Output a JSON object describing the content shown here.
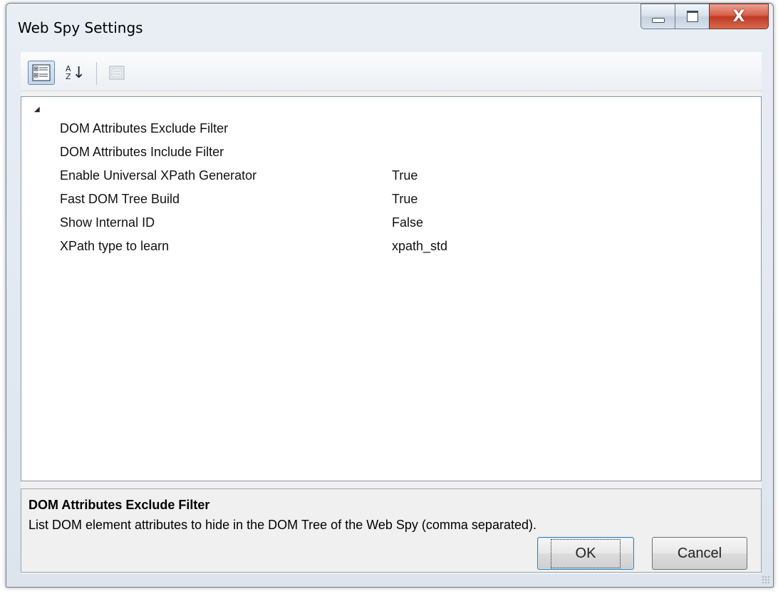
{
  "window": {
    "title": "Web Spy Settings",
    "minimize_label": "",
    "maximize_label": "",
    "close_label": "X"
  },
  "toolbar": {
    "categorized_icon": "categorized-icon",
    "alphabetical_icon": "sort-az-icon",
    "property_pages_icon": "property-pages-icon",
    "sort_letters_top": "A",
    "sort_letters_bottom": "Z",
    "sort_arrow": "↓"
  },
  "grid": {
    "category_expander": "◢",
    "properties": [
      {
        "name": "DOM Attributes Exclude Filter",
        "value": ""
      },
      {
        "name": "DOM Attributes Include Filter",
        "value": ""
      },
      {
        "name": "Enable Universal XPath Generator",
        "value": "True"
      },
      {
        "name": "Fast DOM Tree Build",
        "value": "True"
      },
      {
        "name": "Show Internal ID",
        "value": "False"
      },
      {
        "name": "XPath type to learn",
        "value": "xpath_std"
      }
    ]
  },
  "help": {
    "title": "DOM Attributes Exclude Filter",
    "description": "List DOM element attributes to hide in the DOM Tree of the Web Spy (comma separated)."
  },
  "buttons": {
    "ok": "OK",
    "cancel": "Cancel"
  }
}
